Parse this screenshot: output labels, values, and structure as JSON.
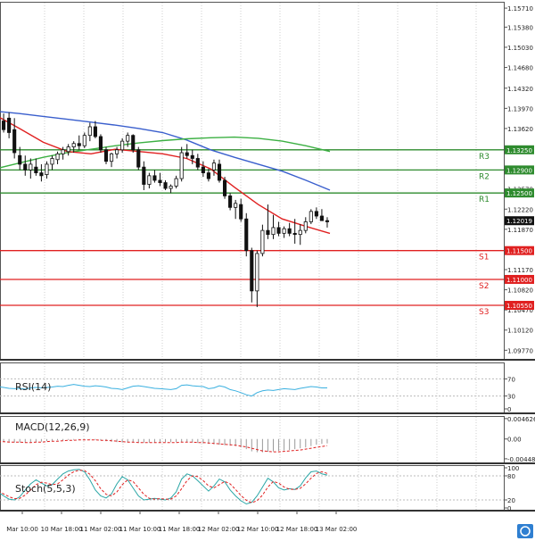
{
  "chart_data": {
    "type": "candlestick",
    "price_axis": {
      "ticks": [
        "1.15710",
        "1.15380",
        "1.15030",
        "1.14680",
        "1.14320",
        "1.13970",
        "1.13620",
        "1.13270",
        "1.12920",
        "1.12570",
        "1.12220",
        "1.11870",
        "1.11520",
        "1.11170",
        "1.10820",
        "1.10470",
        "1.10120",
        "1.09770"
      ],
      "ylim": [
        1.0962,
        1.1582
      ]
    },
    "time_axis": {
      "labels": [
        "Mar 10:00",
        "10 Mar 18:00",
        "11 Mar 02:00",
        "11 Mar 10:00",
        "11 Mar 18:00",
        "12 Mar 02:00",
        "12 Mar 10:00",
        "12 Mar 18:00",
        "13 Mar 02:00"
      ]
    },
    "last_price": "1.12019",
    "levels": [
      {
        "name": "R3",
        "label": "1.13250",
        "value": 1.1325,
        "color": "#2e8b2e"
      },
      {
        "name": "R2",
        "label": "1.12900",
        "value": 1.129,
        "color": "#2e8b2e"
      },
      {
        "name": "R1",
        "label": "1.12500",
        "value": 1.125,
        "color": "#2e8b2e"
      },
      {
        "name": "S1",
        "label": "1.11500",
        "value": 1.115,
        "color": "#e02020"
      },
      {
        "name": "S2",
        "label": "1.11000",
        "value": 1.11,
        "color": "#e02020"
      },
      {
        "name": "S3",
        "label": "1.10550",
        "value": 1.1055,
        "color": "#e02020"
      }
    ],
    "candles": [
      [
        1.1392,
        1.1397,
        1.1365,
        1.1372
      ],
      [
        1.1375,
        1.1388,
        1.1355,
        1.136
      ],
      [
        1.138,
        1.139,
        1.1345,
        1.1355
      ],
      [
        1.136,
        1.138,
        1.131,
        1.132
      ],
      [
        1.1315,
        1.133,
        1.129,
        1.13
      ],
      [
        1.13,
        1.1315,
        1.128,
        1.129
      ],
      [
        1.129,
        1.131,
        1.1275,
        1.13
      ],
      [
        1.1295,
        1.131,
        1.128,
        1.1285
      ],
      [
        1.1285,
        1.13,
        1.127,
        1.128
      ],
      [
        1.1282,
        1.1305,
        1.1275,
        1.13
      ],
      [
        1.13,
        1.1315,
        1.129,
        1.131
      ],
      [
        1.1308,
        1.1322,
        1.13,
        1.1318
      ],
      [
        1.1318,
        1.133,
        1.1308,
        1.1325
      ],
      [
        1.1322,
        1.1335,
        1.1315,
        1.133
      ],
      [
        1.133,
        1.134,
        1.132,
        1.1336
      ],
      [
        1.1336,
        1.135,
        1.1325,
        1.1332
      ],
      [
        1.1332,
        1.1355,
        1.1328,
        1.135
      ],
      [
        1.135,
        1.1372,
        1.134,
        1.1365
      ],
      [
        1.1365,
        1.1375,
        1.1345,
        1.1348
      ],
      [
        1.1348,
        1.1352,
        1.132,
        1.1325
      ],
      [
        1.1325,
        1.133,
        1.13,
        1.1305
      ],
      [
        1.1305,
        1.132,
        1.1295,
        1.1318
      ],
      [
        1.1318,
        1.133,
        1.131,
        1.1325
      ],
      [
        1.1325,
        1.1345,
        1.132,
        1.134
      ],
      [
        1.134,
        1.1355,
        1.133,
        1.135
      ],
      [
        1.135,
        1.1352,
        1.132,
        1.1325
      ],
      [
        1.1325,
        1.133,
        1.129,
        1.1295
      ],
      [
        1.1295,
        1.1305,
        1.1255,
        1.1265
      ],
      [
        1.1265,
        1.1285,
        1.1258,
        1.128
      ],
      [
        1.128,
        1.129,
        1.1268,
        1.1272
      ],
      [
        1.1272,
        1.1285,
        1.1262,
        1.1268
      ],
      [
        1.1268,
        1.1272,
        1.1255,
        1.1258
      ],
      [
        1.1258,
        1.1265,
        1.125,
        1.1262
      ],
      [
        1.1262,
        1.128,
        1.1258,
        1.1275
      ],
      [
        1.1275,
        1.133,
        1.127,
        1.132
      ],
      [
        1.132,
        1.1335,
        1.131,
        1.1315
      ],
      [
        1.1315,
        1.1325,
        1.13,
        1.131
      ],
      [
        1.131,
        1.1318,
        1.129,
        1.1295
      ],
      [
        1.1295,
        1.1305,
        1.1278,
        1.1285
      ],
      [
        1.1285,
        1.1292,
        1.127,
        1.1275
      ],
      [
        1.129,
        1.1308,
        1.128,
        1.1302
      ],
      [
        1.13,
        1.1308,
        1.1268,
        1.1272
      ],
      [
        1.1272,
        1.1278,
        1.124,
        1.1245
      ],
      [
        1.1245,
        1.125,
        1.122,
        1.1225
      ],
      [
        1.1225,
        1.1238,
        1.1205,
        1.1232
      ],
      [
        1.123,
        1.124,
        1.12,
        1.1205
      ],
      [
        1.1205,
        1.1215,
        1.114,
        1.115
      ],
      [
        1.115,
        1.1155,
        1.106,
        1.108
      ],
      [
        1.108,
        1.115,
        1.1052,
        1.1145
      ],
      [
        1.1145,
        1.1195,
        1.114,
        1.1185
      ],
      [
        1.1185,
        1.123,
        1.117,
        1.1178
      ],
      [
        1.1178,
        1.1212,
        1.117,
        1.119
      ],
      [
        1.119,
        1.12,
        1.1175,
        1.118
      ],
      [
        1.118,
        1.1192,
        1.1172,
        1.1188
      ],
      [
        1.1188,
        1.1198,
        1.1175,
        1.118
      ],
      [
        1.118,
        1.1205,
        1.1162,
        1.1178
      ],
      [
        1.1178,
        1.1196,
        1.116,
        1.1185
      ],
      [
        1.1185,
        1.1208,
        1.118,
        1.12
      ],
      [
        1.12,
        1.1222,
        1.1196,
        1.1218
      ],
      [
        1.1218,
        1.1225,
        1.1205,
        1.121
      ],
      [
        1.121,
        1.1222,
        1.1202,
        1.1202
      ],
      [
        1.1202,
        1.1208,
        1.119,
        1.12
      ]
    ],
    "moving_averages": [
      {
        "color": "#3a5fcd",
        "values": [
          1.1392,
          1.1388,
          1.1383,
          1.1378,
          1.1373,
          1.1368,
          1.1362,
          1.1355,
          1.1342,
          1.1325,
          1.1312,
          1.13,
          1.1288,
          1.1272,
          1.1255
        ]
      },
      {
        "color": "#3cb043",
        "values": [
          1.1292,
          1.1302,
          1.1312,
          1.132,
          1.1326,
          1.1332,
          1.1337,
          1.1341,
          1.1344,
          1.1346,
          1.1347,
          1.1345,
          1.134,
          1.1332,
          1.1322
        ]
      },
      {
        "color": "#e02020",
        "values": [
          1.1385,
          1.1362,
          1.1338,
          1.1322,
          1.1318,
          1.1326,
          1.1322,
          1.1318,
          1.131,
          1.1292,
          1.126,
          1.123,
          1.1205,
          1.1192,
          1.118
        ]
      }
    ],
    "indicators": [
      {
        "name": "RSI(14)",
        "ticks": [
          "70",
          "30",
          "0"
        ],
        "levels": [
          70,
          30
        ],
        "range": [
          0,
          100
        ],
        "values": [
          52,
          50,
          48,
          47,
          48,
          46,
          49,
          50,
          49,
          50,
          51,
          53,
          52,
          55,
          57,
          55,
          53,
          52,
          54,
          53,
          51,
          48,
          47,
          45,
          49,
          53,
          54,
          52,
          50,
          48,
          47,
          46,
          45,
          47,
          55,
          56,
          54,
          53,
          52,
          47,
          49,
          54,
          51,
          45,
          42,
          38,
          33,
          30,
          38,
          42,
          44,
          43,
          45,
          47,
          46,
          45,
          48,
          50,
          52,
          51,
          49,
          49
        ]
      },
      {
        "name": "MACD(12,26,9)",
        "ticks": [
          "0.004626",
          "0.00",
          "-0.004483"
        ],
        "range": [
          -0.0045,
          0.0046
        ],
        "values": [
          -0.0005,
          -0.0006,
          -0.0007,
          -0.0008,
          -0.0008,
          -0.0008,
          -0.0007,
          -0.0007,
          -0.0006,
          -0.0005,
          -0.0004,
          -0.0003,
          -0.0003,
          -0.0002,
          -0.0002,
          -0.0001,
          -0.0001,
          -0.0001,
          -0.0002,
          -0.0003,
          -0.0005,
          -0.0006,
          -0.0007,
          -0.0008,
          -0.0008,
          -0.0008,
          -0.0008,
          -0.0008,
          -0.0008,
          -0.0008,
          -0.0008,
          -0.0007,
          -0.0007,
          -0.0007,
          -0.0007,
          -0.0007,
          -0.0008,
          -0.0009,
          -0.001,
          -0.0011,
          -0.0012,
          -0.0013,
          -0.0014,
          -0.0015,
          -0.0016,
          -0.0019,
          -0.0023,
          -0.0028,
          -0.003,
          -0.003,
          -0.0029,
          -0.0028,
          -0.0027,
          -0.0026,
          -0.0025,
          -0.0023,
          -0.0021,
          -0.0019,
          -0.0016,
          -0.0013,
          -0.0011,
          -0.001
        ],
        "signal": [
          -0.0006,
          -0.0006,
          -0.0007,
          -0.0007,
          -0.0007,
          -0.0008,
          -0.0008,
          -0.0007,
          -0.0007,
          -0.0006,
          -0.0005,
          -0.0005,
          -0.0004,
          -0.0003,
          -0.0003,
          -0.0002,
          -0.0002,
          -0.0002,
          -0.0002,
          -0.0003,
          -0.0003,
          -0.0004,
          -0.0005,
          -0.0006,
          -0.0007,
          -0.0007,
          -0.0008,
          -0.0008,
          -0.0008,
          -0.0008,
          -0.0008,
          -0.0008,
          -0.0008,
          -0.0008,
          -0.0007,
          -0.0007,
          -0.0007,
          -0.0008,
          -0.0008,
          -0.0009,
          -0.001,
          -0.0011,
          -0.0012,
          -0.0013,
          -0.0014,
          -0.0016,
          -0.0018,
          -0.0021,
          -0.0024,
          -0.0027,
          -0.0028,
          -0.0029,
          -0.0029,
          -0.0028,
          -0.0027,
          -0.0026,
          -0.0025,
          -0.0023,
          -0.0021,
          -0.0019,
          -0.0017,
          -0.0015
        ]
      },
      {
        "name": "Stoch(5,5,3)",
        "ticks": [
          "100",
          "80",
          "20",
          "0"
        ],
        "levels": [
          80,
          20
        ],
        "range": [
          0,
          100
        ],
        "k": [
          40,
          30,
          22,
          20,
          28,
          45,
          60,
          70,
          62,
          55,
          58,
          72,
          85,
          92,
          95,
          96,
          90,
          70,
          45,
          30,
          25,
          35,
          60,
          78,
          70,
          50,
          30,
          20,
          22,
          24,
          22,
          20,
          25,
          40,
          72,
          85,
          80,
          68,
          55,
          42,
          55,
          72,
          65,
          45,
          30,
          18,
          10,
          14,
          30,
          52,
          74,
          65,
          50,
          45,
          48,
          46,
          55,
          75,
          90,
          92,
          85,
          82
        ],
        "d": [
          42,
          35,
          28,
          23,
          24,
          32,
          45,
          58,
          64,
          62,
          58,
          60,
          70,
          82,
          90,
          94,
          93,
          84,
          68,
          48,
          34,
          30,
          40,
          58,
          70,
          66,
          50,
          34,
          24,
          22,
          23,
          22,
          22,
          30,
          48,
          68,
          80,
          78,
          68,
          55,
          50,
          58,
          66,
          60,
          46,
          31,
          19,
          13,
          18,
          32,
          52,
          66,
          62,
          52,
          47,
          46,
          49,
          60,
          74,
          86,
          90,
          86
        ]
      }
    ]
  }
}
